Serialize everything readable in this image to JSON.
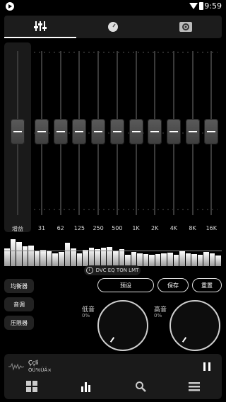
{
  "status_bar": {
    "time": "9:59"
  },
  "tabs": [
    {
      "icon": "equalizer-icon",
      "active": true
    },
    {
      "icon": "tone-knob-icon",
      "active": false
    },
    {
      "icon": "speaker-icon",
      "active": false
    }
  ],
  "equalizer": {
    "gain_label": "增益",
    "bands": [
      "31",
      "62",
      "125",
      "250",
      "500",
      "1K",
      "2K",
      "4K",
      "8K",
      "16K"
    ]
  },
  "spectrum": {
    "levels": [
      0.62,
      0.95,
      0.85,
      0.7,
      0.72,
      0.55,
      0.58,
      0.52,
      0.46,
      0.5,
      0.82,
      0.62,
      0.46,
      0.58,
      0.66,
      0.6,
      0.64,
      0.68,
      0.55,
      0.6,
      0.4,
      0.5,
      0.45,
      0.42,
      0.4,
      0.42,
      0.44,
      0.48,
      0.4,
      0.52,
      0.44,
      0.42,
      0.4,
      0.5,
      0.45,
      0.38
    ]
  },
  "effects_chip": {
    "label": "DVC EQ TON LMT"
  },
  "side_buttons": {
    "equalizer": "均衡器",
    "tone": "音调",
    "limiter": "压限器"
  },
  "actions": {
    "preset": "预设",
    "save": "保存",
    "reset": "重置"
  },
  "bass": {
    "label": "低音",
    "value": "0%"
  },
  "treble": {
    "label": "高音",
    "value": "0%"
  },
  "now_playing": {
    "title": "Ççlì",
    "artist": "ÓÚ%ÚÄ×"
  },
  "bottom_nav": [
    "grid-icon",
    "equalizer-bars-icon",
    "search-icon",
    "menu-icon"
  ]
}
